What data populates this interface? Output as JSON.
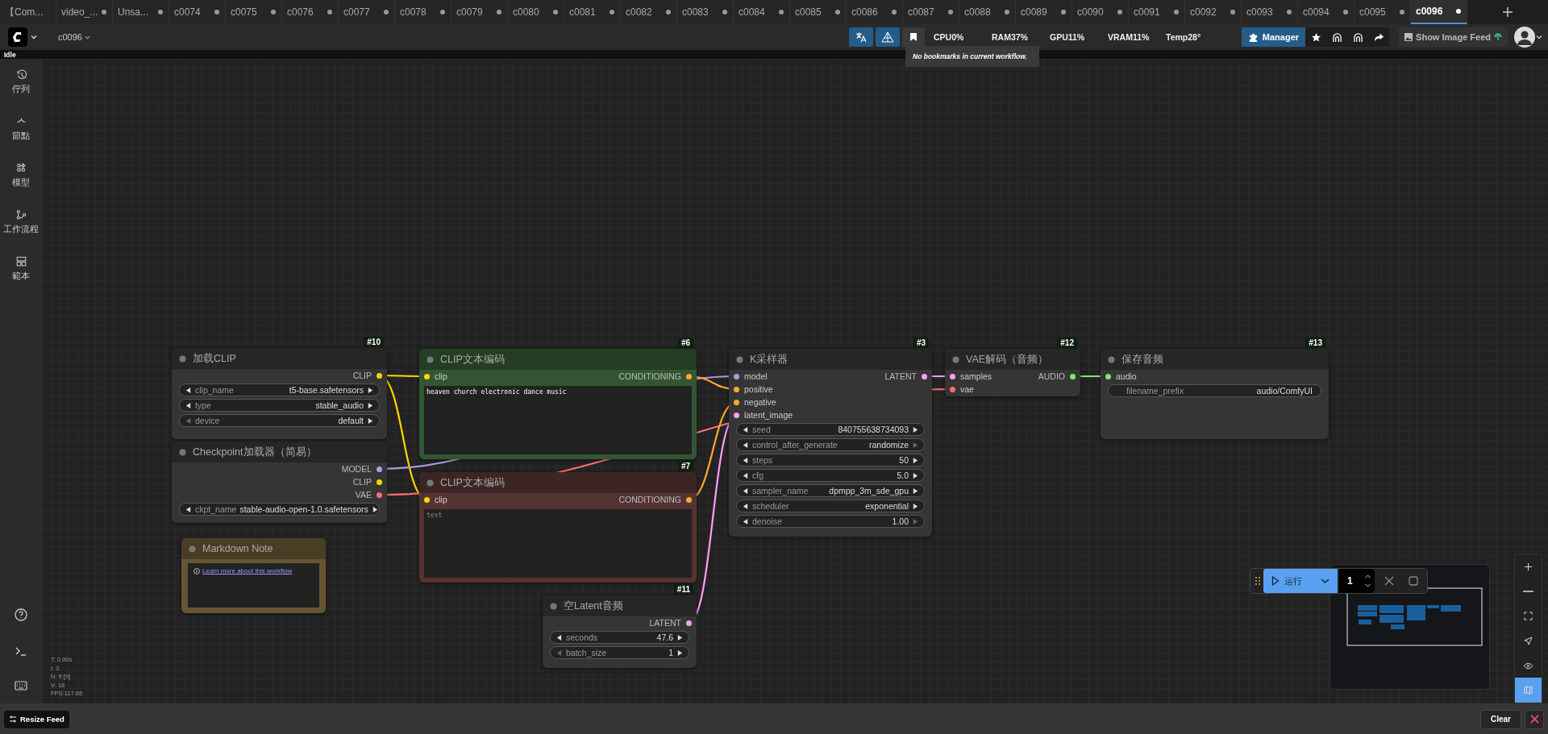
{
  "tabs": [
    {
      "label": "【Com...",
      "modified": false,
      "selected": false
    },
    {
      "label": "video_...",
      "modified": true,
      "selected": false
    },
    {
      "label": "Unsa...",
      "modified": true,
      "selected": false
    },
    {
      "label": "c0074",
      "modified": true,
      "selected": false
    },
    {
      "label": "c0075",
      "modified": true,
      "selected": false
    },
    {
      "label": "c0076",
      "modified": true,
      "selected": false
    },
    {
      "label": "c0077",
      "modified": true,
      "selected": false
    },
    {
      "label": "c0078",
      "modified": true,
      "selected": false
    },
    {
      "label": "c0079",
      "modified": true,
      "selected": false
    },
    {
      "label": "c0080",
      "modified": true,
      "selected": false
    },
    {
      "label": "c0081",
      "modified": true,
      "selected": false
    },
    {
      "label": "c0082",
      "modified": true,
      "selected": false
    },
    {
      "label": "c0083",
      "modified": true,
      "selected": false
    },
    {
      "label": "c0084",
      "modified": true,
      "selected": false
    },
    {
      "label": "c0085",
      "modified": true,
      "selected": false
    },
    {
      "label": "c0086",
      "modified": true,
      "selected": false
    },
    {
      "label": "c0087",
      "modified": true,
      "selected": false
    },
    {
      "label": "c0088",
      "modified": true,
      "selected": false
    },
    {
      "label": "c0089",
      "modified": true,
      "selected": false
    },
    {
      "label": "c0090",
      "modified": true,
      "selected": false
    },
    {
      "label": "c0091",
      "modified": true,
      "selected": false
    },
    {
      "label": "c0092",
      "modified": true,
      "selected": false
    },
    {
      "label": "c0093",
      "modified": true,
      "selected": false
    },
    {
      "label": "c0094",
      "modified": true,
      "selected": false
    },
    {
      "label": "c0095",
      "modified": true,
      "selected": false
    },
    {
      "label": "c0096",
      "modified": true,
      "selected": true
    }
  ],
  "toolbar": {
    "workflow_name": "c0096",
    "stats": [
      "CPU0%",
      "RAM37%",
      "GPU11%",
      "VRAM11%",
      "Temp28°"
    ],
    "manager": "Manager",
    "image_feed": "Show Image Feed",
    "tooltip": "No bookmarks in current workflow."
  },
  "status": "Idle",
  "sidebar": {
    "items": [
      {
        "kind": "history",
        "label": "佇列"
      },
      {
        "kind": "nodes",
        "label": "節點"
      },
      {
        "kind": "models",
        "label": "模型"
      },
      {
        "kind": "workflows",
        "label": "工作流程"
      },
      {
        "kind": "templates",
        "label": "範本"
      }
    ]
  },
  "nodes": [
    {
      "kind": "standard",
      "title": "加载CLIP",
      "number": "#10",
      "color": "#353535",
      "outputs": [
        {
          "name": "CLIP",
          "color": "#ffd500"
        }
      ],
      "widgets": [
        {
          "kind": "combo",
          "label": "clip_name",
          "value": "t5-base.safetensors",
          "left_disabled": false,
          "right_disabled": false
        },
        {
          "kind": "combo",
          "label": "type",
          "value": "stable_audio",
          "left_disabled": false,
          "right_disabled": false
        },
        {
          "kind": "combo",
          "label": "device",
          "value": "default",
          "left_disabled": true,
          "right_disabled": false
        }
      ]
    },
    {
      "kind": "standard",
      "title": "Checkpoint加载器（简易）",
      "color": "#353535",
      "outputs": [
        {
          "name": "MODEL",
          "color": "#b39ddb"
        },
        {
          "name": "CLIP",
          "color": "#ffd500"
        },
        {
          "name": "VAE",
          "color": "#ff6e6e"
        }
      ],
      "widgets": [
        {
          "kind": "combo",
          "label": "ckpt_name",
          "value": "stable-audio-open-1.0.safetensors",
          "left_disabled": false,
          "right_disabled": false
        }
      ]
    },
    {
      "kind": "markdown",
      "title": "Markdown Note",
      "color": "#665533",
      "link": "Learn more about this workflow"
    },
    {
      "kind": "standard",
      "title": "CLIP文本编码",
      "number": "#6",
      "color": "#335533",
      "inputs": [
        {
          "name": "clip",
          "color": "#ffd500"
        }
      ],
      "outputs": [
        {
          "name": "CONDITIONING",
          "color": "#ffa931"
        }
      ],
      "textarea": {
        "value": "heaven church electronic dance music"
      }
    },
    {
      "kind": "standard",
      "title": "CLIP文本编码",
      "number": "#7",
      "color": "#553333",
      "inputs": [
        {
          "name": "clip",
          "color": "#ffd500"
        }
      ],
      "outputs": [
        {
          "name": "CONDITIONING",
          "color": "#ffa931"
        }
      ],
      "textarea": {
        "placeholder": "text"
      }
    },
    {
      "kind": "standard",
      "title": "空Latent音频",
      "number": "#11",
      "color": "#353535",
      "outputs": [
        {
          "name": "LATENT",
          "color": "#ff9cf9"
        }
      ],
      "widgets": [
        {
          "kind": "number",
          "label": "seconds",
          "value": "47.6",
          "left_disabled": false,
          "right_disabled": false
        },
        {
          "kind": "number",
          "label": "batch_size",
          "value": "1",
          "left_disabled": true,
          "right_disabled": false
        }
      ]
    },
    {
      "kind": "standard",
      "title": "K采样器",
      "number": "#3",
      "color": "#353535",
      "inputs": [
        {
          "name": "model",
          "color": "#b39ddb"
        },
        {
          "name": "positive",
          "color": "#ffa931"
        },
        {
          "name": "negative",
          "color": "#ffa931"
        },
        {
          "name": "latent_image",
          "color": "#ff9cf9"
        }
      ],
      "outputs": [
        {
          "name": "LATENT",
          "color": "#ff9cf9"
        }
      ],
      "widgets": [
        {
          "kind": "number",
          "label": "seed",
          "value": "840755638734093",
          "left_disabled": false,
          "right_disabled": false
        },
        {
          "kind": "combo",
          "label": "control_after_generate",
          "value": "randomize",
          "left_disabled": false,
          "right_disabled": true
        },
        {
          "kind": "number",
          "label": "steps",
          "value": "50",
          "left_disabled": false,
          "right_disabled": false
        },
        {
          "kind": "number",
          "label": "cfg",
          "value": "5.0",
          "left_disabled": false,
          "right_disabled": false
        },
        {
          "kind": "combo",
          "label": "sampler_name",
          "value": "dpmpp_3m_sde_gpu",
          "left_disabled": false,
          "right_disabled": false
        },
        {
          "kind": "combo",
          "label": "scheduler",
          "value": "exponential",
          "left_disabled": false,
          "right_disabled": false
        },
        {
          "kind": "number",
          "label": "denoise",
          "value": "1.00",
          "left_disabled": false,
          "right_disabled": true
        }
      ]
    },
    {
      "kind": "standard",
      "title": "VAE解码（音频）",
      "number": "#12",
      "color": "#353535",
      "inputs": [
        {
          "name": "samples",
          "color": "#ff9cf9"
        },
        {
          "name": "vae",
          "color": "#ff6e6e"
        }
      ],
      "outputs": [
        {
          "name": "AUDIO",
          "color": "#7dea6c"
        }
      ]
    },
    {
      "kind": "standard",
      "title": "保存音频",
      "number": "#13",
      "color": "#353535",
      "inputs": [
        {
          "name": "audio",
          "color": "#7dea6c"
        }
      ],
      "widgets": [
        {
          "kind": "text",
          "label": "filename_prefix",
          "value": "audio/ComfyUI"
        }
      ]
    }
  ],
  "canvas_stats": [
    "T: 0.00s",
    "I: 0",
    "N: 9 [9]",
    "V: 18",
    "FPS:117.65"
  ],
  "run_bar": {
    "label": "运行",
    "count": "1"
  },
  "canvas_tools": [
    {
      "kind": "zoom-in",
      "selected": false
    },
    {
      "kind": "zoom-out",
      "selected": false
    },
    {
      "kind": "fit",
      "selected": false
    },
    {
      "kind": "navigate",
      "selected": false
    },
    {
      "kind": "visibility",
      "selected": false
    },
    {
      "kind": "minimap",
      "selected": true
    }
  ],
  "bottom_bar": {
    "resize": "Resize Feed",
    "clear": "Clear"
  }
}
